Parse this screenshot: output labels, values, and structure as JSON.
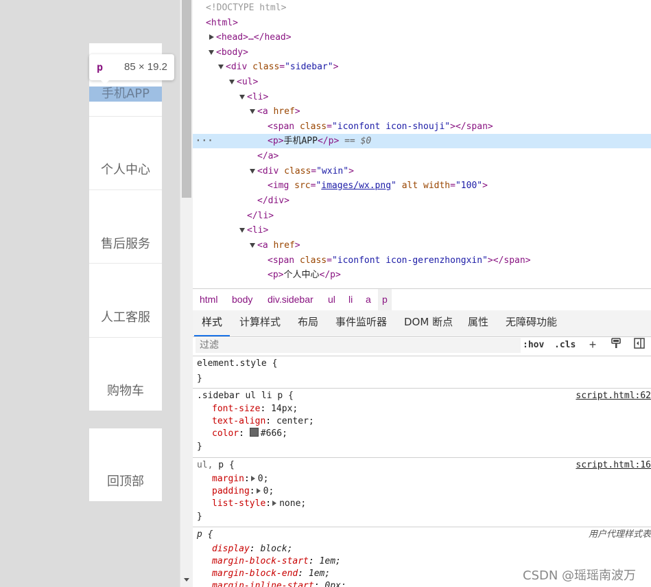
{
  "preview": {
    "tooltip": {
      "tag": "p",
      "dimensions": "85 × 19.2"
    },
    "sidebar_items": [
      "手机APP",
      "个人中心",
      "售后服务",
      "人工客服",
      "购物车"
    ],
    "back_to_top": "回顶部"
  },
  "elements": {
    "doctype": "<!DOCTYPE html>",
    "selected_suffix": "== $0",
    "texts": {
      "html_open": "<html>",
      "head": "<head>…</head>",
      "body_open": "<body>",
      "div_open": "<div ",
      "class_attr": "class",
      "sidebar_val": "\"sidebar\"",
      "ul_open": "<ul>",
      "li_open": "<li>",
      "a_open": "<a ",
      "href_attr": "href",
      "gt": ">",
      "span_open": "<span ",
      "iconfont_shouji": "\"iconfont icon-shouji\"",
      "span_close": "></span>",
      "p_open": "<p>",
      "p_close": "</p>",
      "p_text1": "手机APP",
      "a_close": "</a>",
      "wxin_val": "\"wxin\"",
      "img_open": "<img ",
      "src_attr": "src",
      "img_src": "images/wx.png",
      "alt_attr": "alt",
      "width_attr": "width",
      "width_val": "\"100\"",
      "div_close": "</div>",
      "li_close": "</li>",
      "iconfont_gerenzhongxin": "\"iconfont icon-gerenzhongxin\"",
      "p_text2": "个人中心",
      "eq": "=",
      "space": " "
    }
  },
  "breadcrumb": [
    "html",
    "body",
    "div.sidebar",
    "ul",
    "li",
    "a",
    "p"
  ],
  "tabs": [
    "样式",
    "计算样式",
    "布局",
    "事件监听器",
    "DOM 断点",
    "属性",
    "无障碍功能"
  ],
  "filter": {
    "placeholder": "过滤",
    "hov": ":hov",
    "cls": ".cls"
  },
  "styles": {
    "element_style": "element.style {",
    "close_brace": "}",
    "rule1": {
      "selector": ".sidebar ul li p {",
      "source": "script.html:62",
      "props": [
        {
          "name": "font-size",
          "value": "14px;"
        },
        {
          "name": "text-align",
          "value": "center;"
        },
        {
          "name": "color",
          "value": "#666;"
        }
      ]
    },
    "rule2": {
      "selector_dim": "ul,",
      "selector": " p {",
      "source": "script.html:16",
      "props": [
        {
          "name": "margin",
          "value": "0;"
        },
        {
          "name": "padding",
          "value": "0;"
        },
        {
          "name": "list-style",
          "value": "none;"
        }
      ]
    },
    "rule3": {
      "selector": "p {",
      "source": "用户代理样式表",
      "props": [
        {
          "name": "display",
          "value": "block;"
        },
        {
          "name": "margin-block-start",
          "value": "1em;"
        },
        {
          "name": "margin-block-end",
          "value": "1em;"
        },
        {
          "name": "margin-inline-start",
          "value": "0px;"
        }
      ]
    },
    "colon": ": "
  },
  "watermark": "CSDN @瑶瑶南波万",
  "colors": {
    "highlight": "#9ebfe3",
    "selected_row": "#cfe8fc",
    "tag": "#881280",
    "attr_name": "#994500",
    "attr_value": "#1a1aa6",
    "prop": "#c80000",
    "active_tab": "#1a73e8"
  }
}
